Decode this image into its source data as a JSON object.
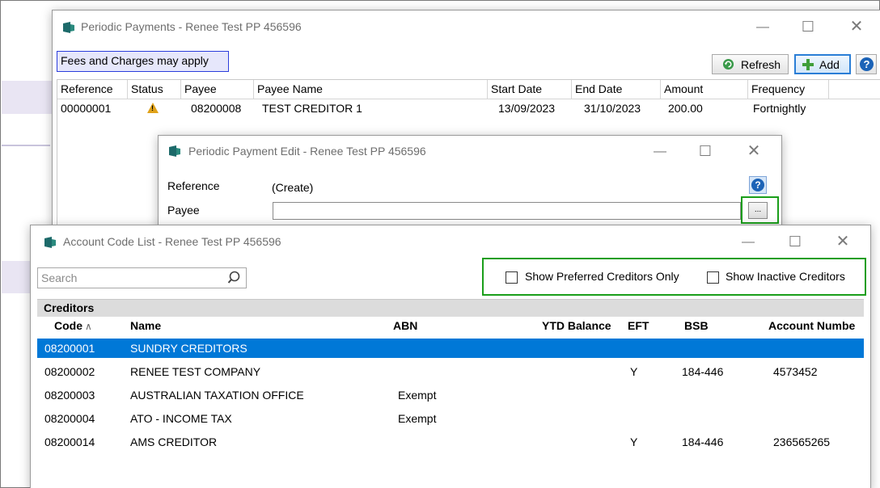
{
  "periodic_payments": {
    "title": "Periodic Payments - Renee Test PP 456596",
    "fees_notice": "Fees and Charges may apply",
    "refresh_label": "Refresh",
    "add_label": "Add",
    "columns": [
      "Reference",
      "Status",
      "Payee",
      "Payee Name",
      "Start Date",
      "End Date",
      "Amount",
      "Frequency"
    ],
    "rows": [
      {
        "reference": "00000001",
        "status": "warning",
        "payee": "08200008",
        "payee_name": "TEST CREDITOR 1",
        "start_date": "13/09/2023",
        "end_date": "31/10/2023",
        "amount": "200.00",
        "frequency": "Fortnightly"
      }
    ]
  },
  "edit_window": {
    "title": "Periodic Payment Edit - Renee Test PP 456596",
    "reference_label": "Reference",
    "reference_value": "(Create)",
    "payee_label": "Payee",
    "payee_value": "",
    "browse_label": "..."
  },
  "account_list": {
    "title": "Account Code List - Renee Test PP 456596",
    "search_placeholder": "Search",
    "show_preferred_label": "Show Preferred Creditors Only",
    "show_inactive_label": "Show Inactive Creditors",
    "section": "Creditors",
    "columns": {
      "code": "Code",
      "name": "Name",
      "abn": "ABN",
      "ytd": "YTD Balance",
      "eft": "EFT",
      "bsb": "BSB",
      "account": "Account Numbe"
    },
    "rows": [
      {
        "code": "08200001",
        "name": "SUNDRY CREDITORS",
        "abn": "",
        "eft": "",
        "bsb": "",
        "account": ""
      },
      {
        "code": "08200002",
        "name": "RENEE TEST COMPANY",
        "abn": "",
        "eft": "Y",
        "bsb": "184-446",
        "account": "4573452"
      },
      {
        "code": "08200003",
        "name": "AUSTRALIAN TAXATION OFFICE",
        "abn": "Exempt",
        "eft": "",
        "bsb": "",
        "account": ""
      },
      {
        "code": "08200004",
        "name": "ATO - INCOME TAX",
        "abn": "Exempt",
        "eft": "",
        "bsb": "",
        "account": ""
      },
      {
        "code": "08200014",
        "name": "AMS CREDITOR",
        "abn": "",
        "eft": "Y",
        "bsb": "184-446",
        "account": "236565265"
      }
    ]
  },
  "colors": {
    "selection": "#0078d7",
    "highlight_box": "#1a9e1a",
    "fees_border": "#2b3ddc",
    "warning": "#e0a21a"
  },
  "icons": [
    "app-icon",
    "minimize-icon",
    "maximize-icon",
    "close-icon",
    "refresh-icon",
    "plus-icon",
    "help-icon",
    "warning-icon",
    "search-icon",
    "sort-ascending-icon"
  ]
}
